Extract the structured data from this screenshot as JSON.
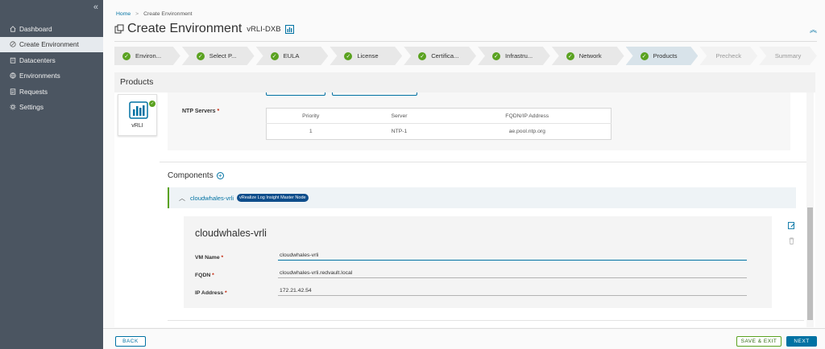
{
  "sidebar": {
    "items": [
      {
        "label": "Dashboard",
        "icon": "home-icon",
        "active": false
      },
      {
        "label": "Create Environment",
        "icon": "create-icon",
        "active": true
      },
      {
        "label": "Datacenters",
        "icon": "building-icon",
        "active": false
      },
      {
        "label": "Environments",
        "icon": "environment-icon",
        "active": false
      },
      {
        "label": "Requests",
        "icon": "list-icon",
        "active": false
      },
      {
        "label": "Settings",
        "icon": "gear-icon",
        "active": false
      }
    ]
  },
  "breadcrumb": {
    "home": "Home",
    "separator": ">",
    "current": "Create Environment"
  },
  "header": {
    "title": "Create Environment",
    "env_name": "vRLI-DXB"
  },
  "stepper": {
    "steps": [
      {
        "label": "Environ...",
        "state": "done"
      },
      {
        "label": "Select P...",
        "state": "done"
      },
      {
        "label": "EULA",
        "state": "done"
      },
      {
        "label": "License",
        "state": "done"
      },
      {
        "label": "Certifica...",
        "state": "done"
      },
      {
        "label": "Infrastru...",
        "state": "done"
      },
      {
        "label": "Network",
        "state": "done"
      },
      {
        "label": "Products",
        "state": "current"
      },
      {
        "label": "Precheck",
        "state": "future"
      },
      {
        "label": "Summary",
        "state": "future"
      }
    ]
  },
  "products": {
    "title": "Products",
    "card_label": "vRLI"
  },
  "ntp": {
    "label": "NTP Servers",
    "required": "*",
    "headers": [
      "Priority",
      "Server",
      "FQDN/IP Address"
    ],
    "rows": [
      [
        "1",
        "NTP-1",
        "ae.pool.ntp.org"
      ]
    ]
  },
  "components": {
    "title": "Components",
    "item_name": "cloudwhales-vrli",
    "item_badge": "vRealize Log Insight Master Node"
  },
  "form": {
    "title": "cloudwhales-vrli",
    "vm_name_label": "VM Name",
    "vm_name_value": "cloudwhales-vrli",
    "fqdn_label": "FQDN",
    "fqdn_value": "cloudwhales-vrli.redvault.local",
    "ip_label": "IP Address",
    "ip_value": "172.21.42.54",
    "required": "*"
  },
  "footer": {
    "back": "BACK",
    "save_exit": "SAVE & EXIT",
    "next": "NEXT"
  },
  "colors": {
    "accent": "#0072a3",
    "success": "#5aa220",
    "sidebar": "#4b5561"
  }
}
